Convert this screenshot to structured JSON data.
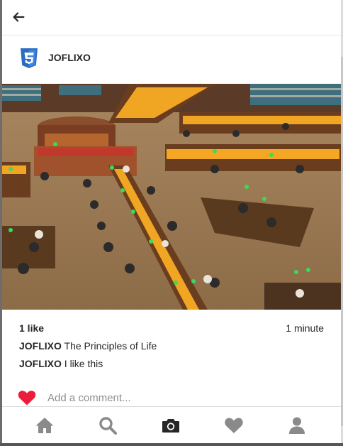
{
  "header": {
    "back_icon": "arrow-left-icon"
  },
  "post": {
    "username": "JOFLIXO",
    "avatar_icon": "css3-logo-icon",
    "photo_alt": "",
    "likes": "1 like",
    "time": "1 minute",
    "captions": [
      {
        "user": "JOFLIXO",
        "text": "The Principles of Life"
      },
      {
        "user": "JOFLIXO",
        "text": "I like this"
      }
    ]
  },
  "comment": {
    "placeholder": "Add a comment...",
    "like_icon": "heart-icon",
    "like_color": "#ed1c3b"
  },
  "tabs": [
    {
      "icon": "home-icon",
      "color": "#8a8a8a"
    },
    {
      "icon": "search-icon",
      "color": "#8a8a8a"
    },
    {
      "icon": "camera-icon",
      "color": "#262626"
    },
    {
      "icon": "heart-icon",
      "color": "#8a8a8a"
    },
    {
      "icon": "user-icon",
      "color": "#8a8a8a"
    }
  ],
  "colors": {
    "brand_blue": "#2b6cc4",
    "text": "#262626"
  }
}
